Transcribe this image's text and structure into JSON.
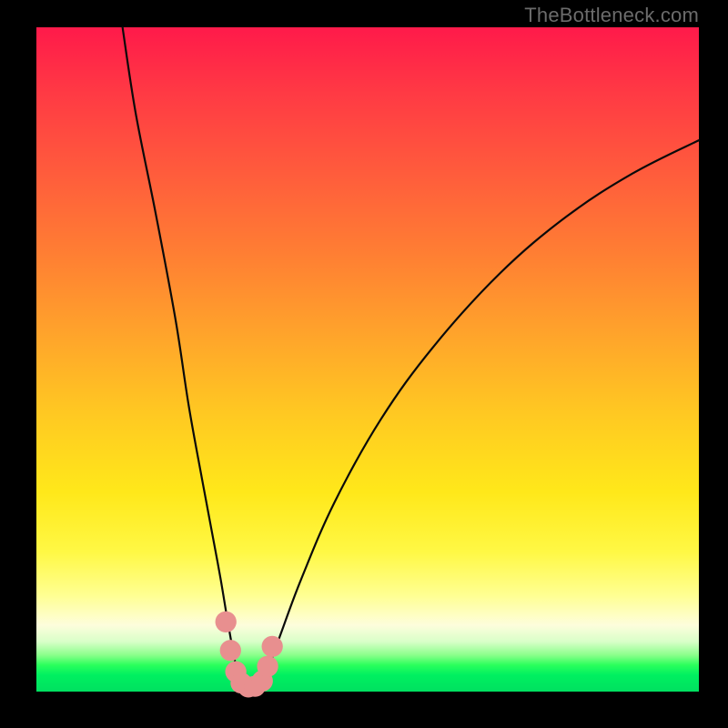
{
  "watermark": "TheBottleneck.com",
  "chart_data": {
    "type": "line",
    "title": "",
    "xlabel": "",
    "ylabel": "",
    "xlim": [
      0,
      100
    ],
    "ylim": [
      0,
      100
    ],
    "series": [
      {
        "name": "left-branch",
        "x": [
          13.0,
          15.0,
          18.0,
          21.0,
          23.0,
          25.0,
          26.5,
          27.8,
          28.8,
          29.6,
          30.2,
          30.7
        ],
        "values": [
          100.0,
          87.0,
          72.0,
          56.0,
          43.0,
          32.0,
          24.0,
          17.0,
          11.0,
          6.5,
          3.5,
          1.5
        ]
      },
      {
        "name": "right-branch",
        "x": [
          34.3,
          35.2,
          37.0,
          40.0,
          45.0,
          52.0,
          60.0,
          70.0,
          80.0,
          90.0,
          100.0
        ],
        "values": [
          1.5,
          4.0,
          9.0,
          17.0,
          28.5,
          41.0,
          52.0,
          63.0,
          71.5,
          78.0,
          83.0
        ]
      },
      {
        "name": "floor",
        "x": [
          30.7,
          31.5,
          32.5,
          33.5,
          34.3
        ],
        "values": [
          1.5,
          0.8,
          0.6,
          0.8,
          1.5
        ]
      }
    ],
    "markers": [
      {
        "x": 28.6,
        "y": 10.5,
        "r": 1.6
      },
      {
        "x": 29.3,
        "y": 6.2,
        "r": 1.6
      },
      {
        "x": 30.1,
        "y": 3.0,
        "r": 1.6
      },
      {
        "x": 30.9,
        "y": 1.3,
        "r": 1.6
      },
      {
        "x": 32.0,
        "y": 0.7,
        "r": 1.6
      },
      {
        "x": 33.0,
        "y": 0.8,
        "r": 1.6
      },
      {
        "x": 34.1,
        "y": 1.6,
        "r": 1.6
      },
      {
        "x": 34.9,
        "y": 3.8,
        "r": 1.6
      },
      {
        "x": 35.6,
        "y": 6.8,
        "r": 1.6
      }
    ],
    "background_gradient_stops": [
      {
        "pos": 0.0,
        "color": "#ff1a4a"
      },
      {
        "pos": 0.1,
        "color": "#ff3a44"
      },
      {
        "pos": 0.22,
        "color": "#ff5c3c"
      },
      {
        "pos": 0.34,
        "color": "#ff7e33"
      },
      {
        "pos": 0.46,
        "color": "#ffa32b"
      },
      {
        "pos": 0.58,
        "color": "#ffc822"
      },
      {
        "pos": 0.7,
        "color": "#ffe81a"
      },
      {
        "pos": 0.79,
        "color": "#fff845"
      },
      {
        "pos": 0.855,
        "color": "#ffff92"
      },
      {
        "pos": 0.9,
        "color": "#fdfddc"
      },
      {
        "pos": 0.925,
        "color": "#d8ffc8"
      },
      {
        "pos": 0.945,
        "color": "#8bff8b"
      },
      {
        "pos": 0.96,
        "color": "#2bff5c"
      },
      {
        "pos": 0.975,
        "color": "#00f060"
      },
      {
        "pos": 1.0,
        "color": "#00e060"
      }
    ]
  }
}
